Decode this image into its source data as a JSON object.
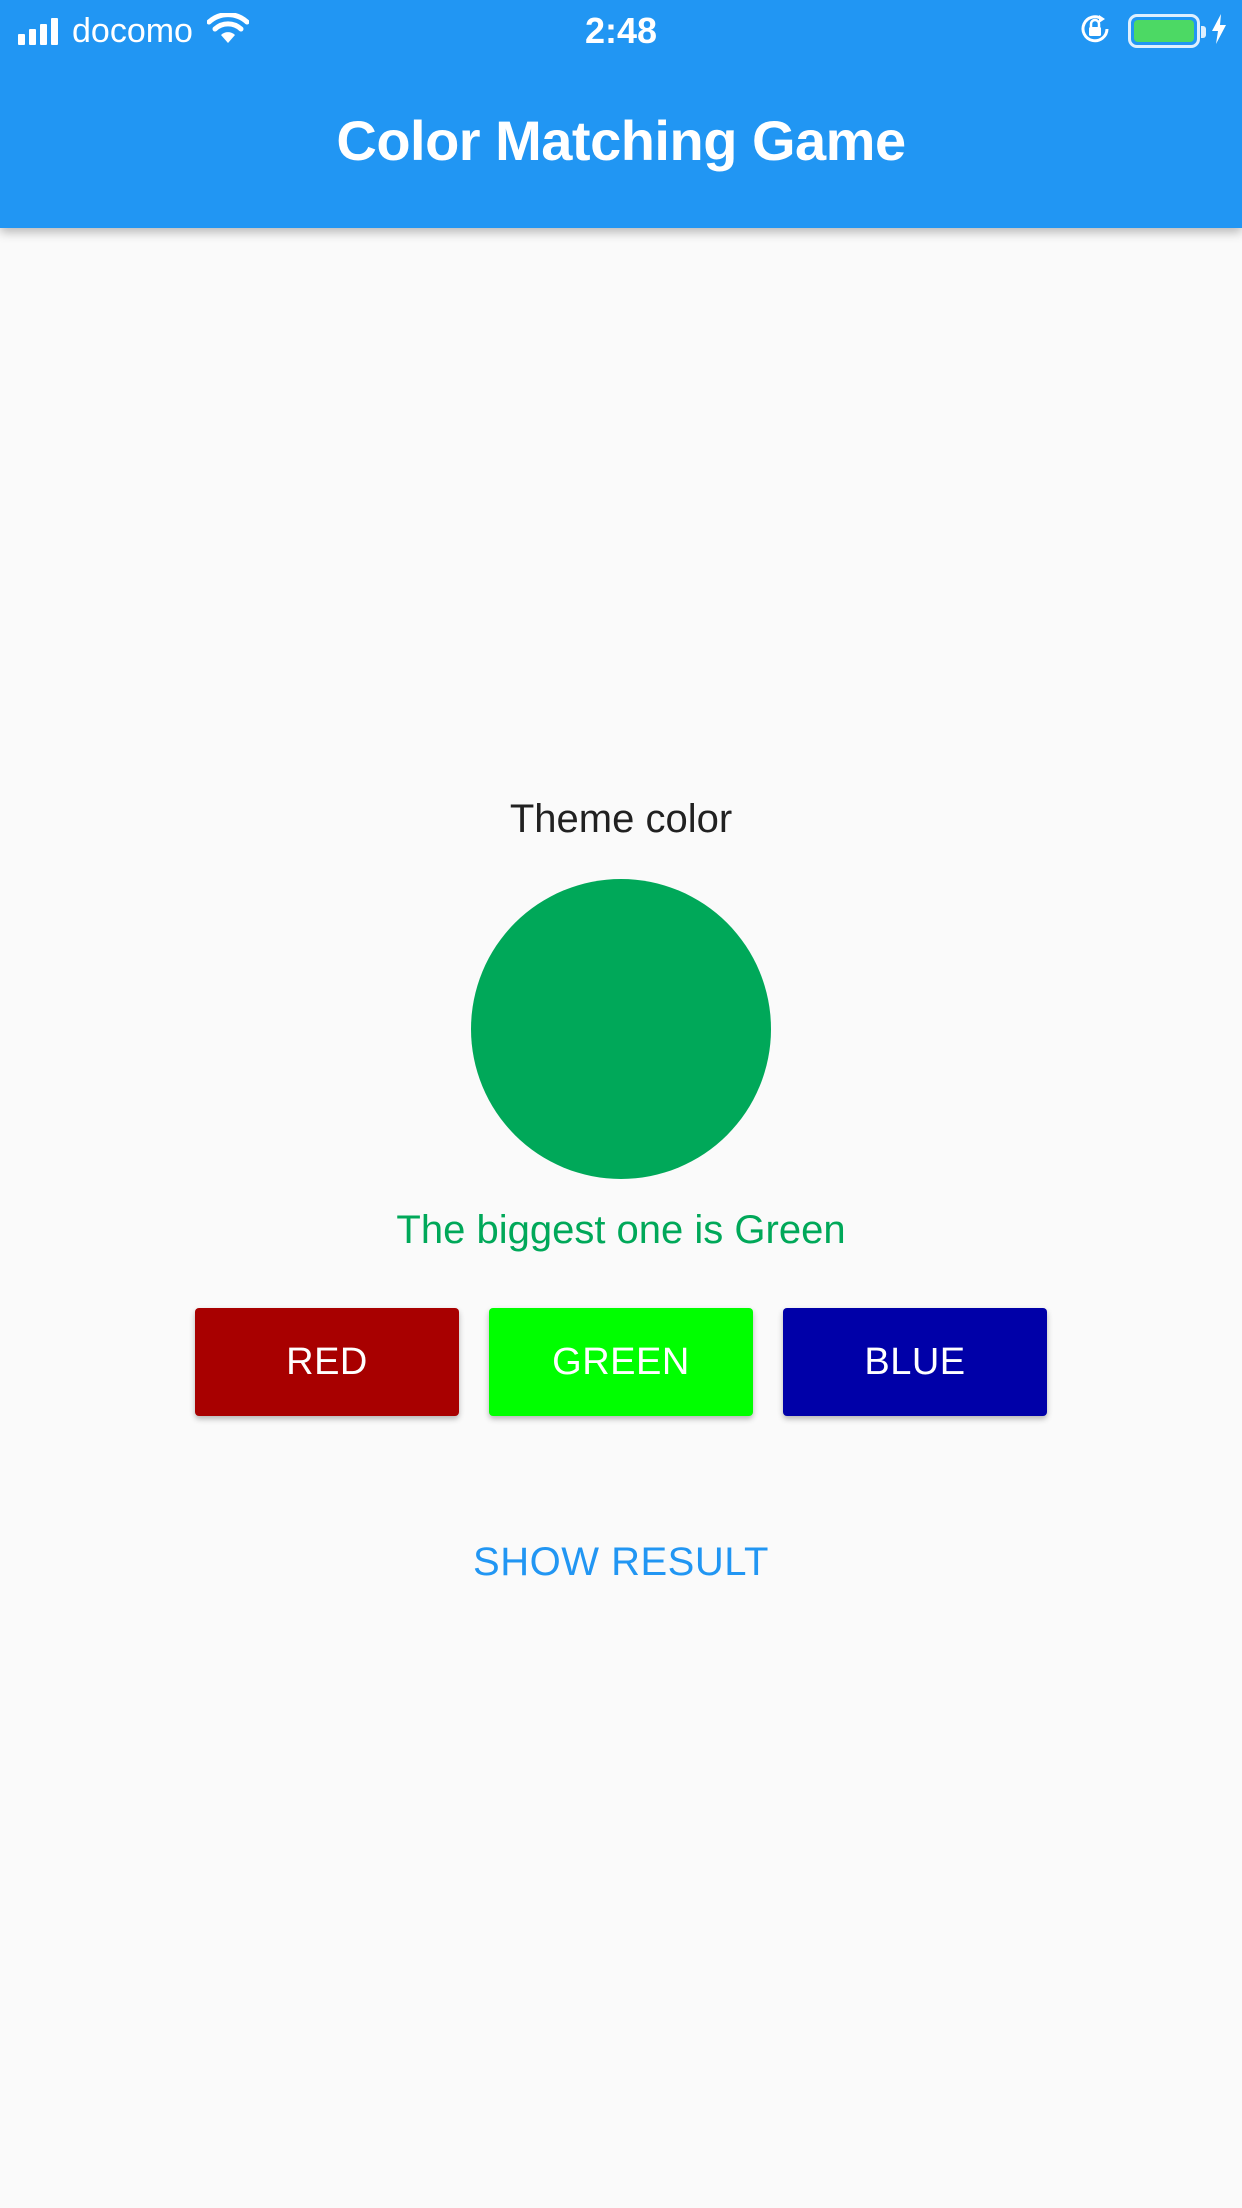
{
  "status_bar": {
    "carrier": "docomo",
    "time": "2:48",
    "icons": [
      "signal-icon",
      "wifi-icon",
      "orientation-lock-icon",
      "battery-icon",
      "charging-bolt-icon"
    ]
  },
  "app_bar": {
    "title": "Color Matching Game",
    "color": "#2196f3"
  },
  "theme": {
    "label": "Theme color",
    "circle_color": "#00a859"
  },
  "result": {
    "text": "The biggest one is Green",
    "color": "#00a859"
  },
  "buttons": [
    {
      "label": "RED",
      "color": "#a80000"
    },
    {
      "label": "GREEN",
      "color": "#00ff00"
    },
    {
      "label": "BLUE",
      "color": "#0000a8"
    }
  ],
  "show_result": {
    "label": "SHOW RESULT",
    "color": "#2196f3"
  }
}
